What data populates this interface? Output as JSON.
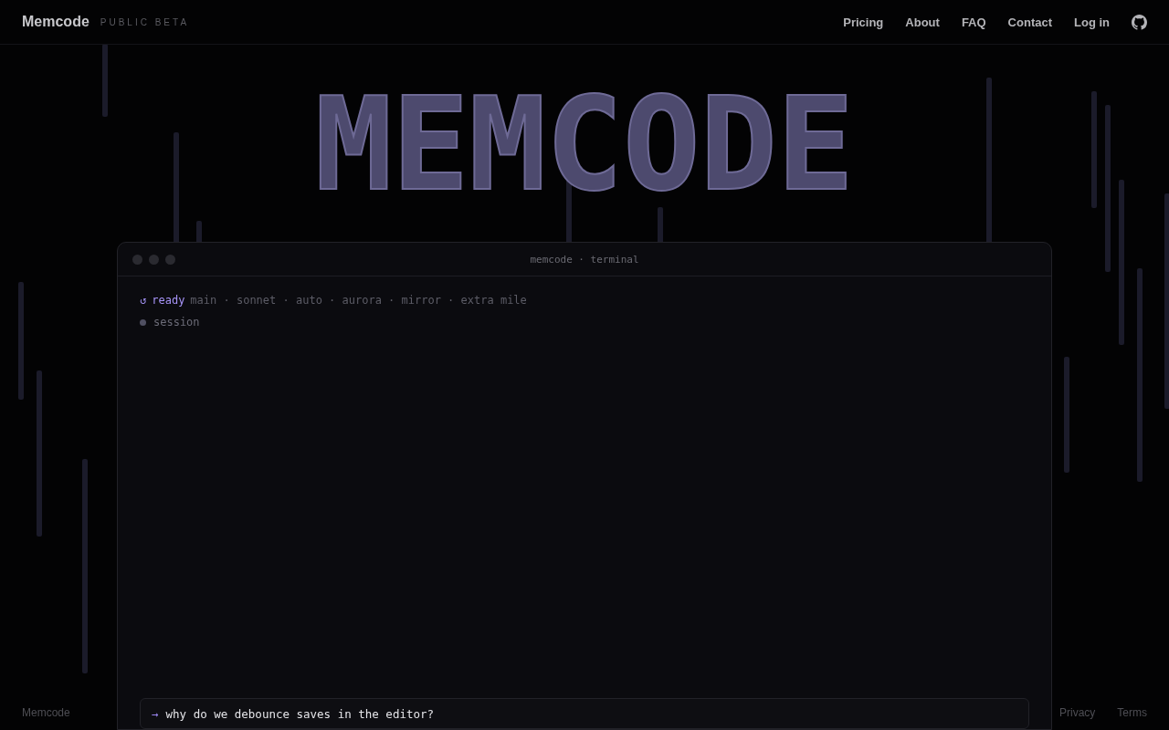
{
  "header": {
    "brand": "Memcode",
    "badge": "PUBLIC BETA",
    "nav": [
      {
        "label": "Pricing"
      },
      {
        "label": "About"
      },
      {
        "label": "FAQ"
      },
      {
        "label": "Contact"
      },
      {
        "label": "Log in"
      }
    ]
  },
  "hero": {
    "title": "MEMCODE"
  },
  "terminal": {
    "title": "memcode · terminal",
    "status": {
      "icon": "↺",
      "state": "ready",
      "details": "main · sonnet · auto · aurora · mirror · extra mile"
    },
    "session": {
      "label": "session"
    },
    "prompt": {
      "arrow": "→",
      "value": "why do we debounce saves in the editor?"
    }
  },
  "footer": {
    "brand": "Memcode",
    "links": [
      {
        "label": "Privacy"
      },
      {
        "label": "Terms"
      }
    ]
  }
}
